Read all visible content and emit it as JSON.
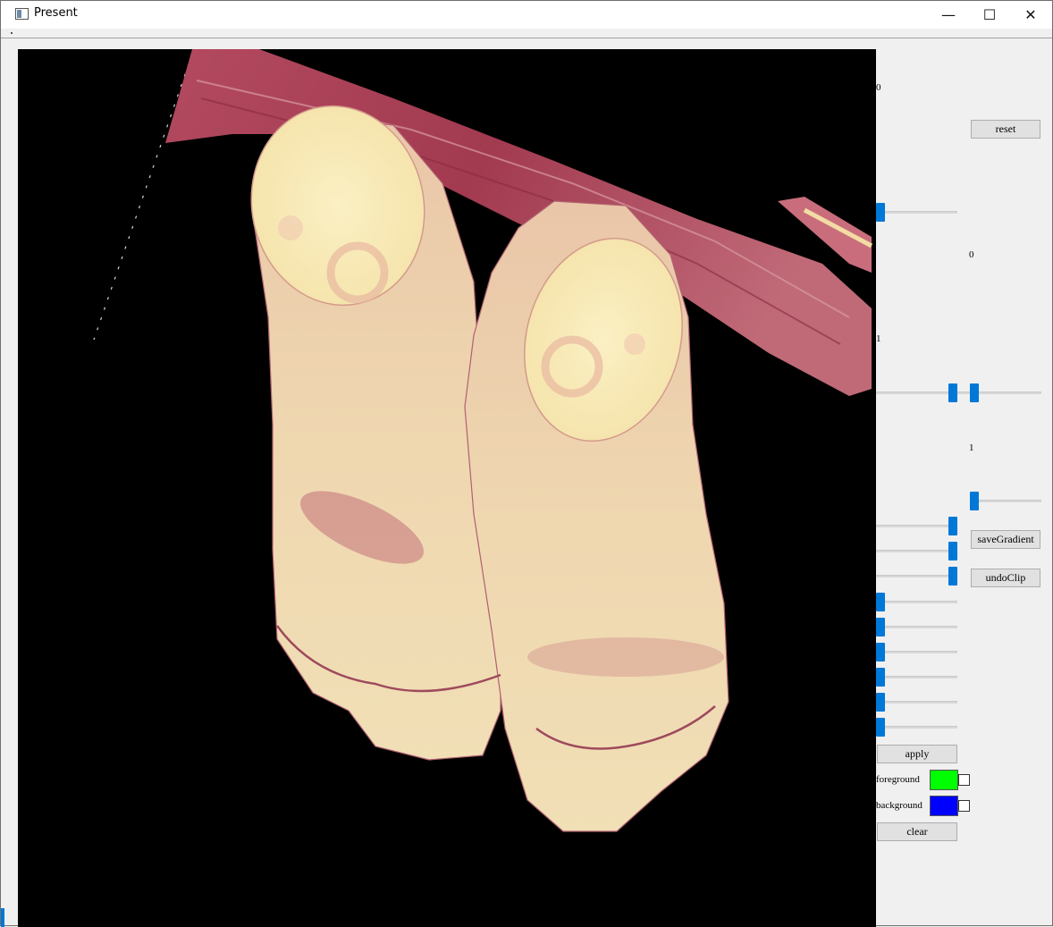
{
  "window": {
    "title": "Present",
    "minimize_glyph": "—",
    "maximize_glyph": "☐",
    "close_glyph": "✕"
  },
  "panel": {
    "value_top": "0",
    "reset_label": "reset",
    "value_mid": "0",
    "value_one_a": "1",
    "value_one_b": "1",
    "save_gradient_label": "saveGradient",
    "undo_clip_label": "undoClip",
    "apply_label": "apply",
    "foreground_label": "foreground",
    "background_label": "background",
    "clear_label": "clear",
    "foreground_color": "#00ff00",
    "background_color": "#0000ff"
  },
  "viewport": {
    "content": "volume-rendering"
  }
}
